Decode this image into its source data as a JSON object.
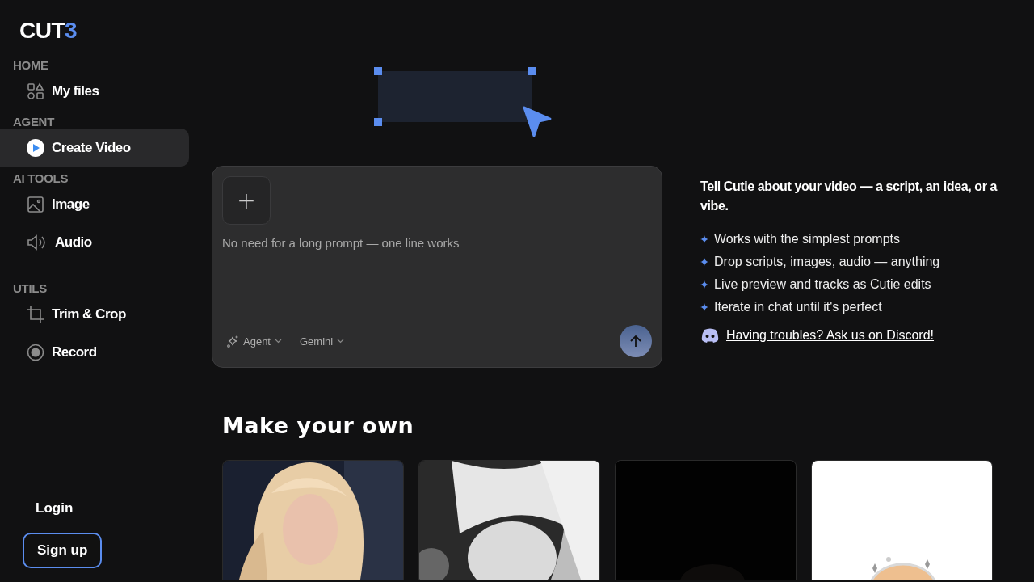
{
  "logo": {
    "text": "CUT",
    "accent": "3"
  },
  "sidebar": {
    "sections": [
      {
        "heading": "HOME",
        "items": [
          {
            "label": "My files",
            "selected": false
          }
        ]
      },
      {
        "heading": "AGENT",
        "items": [
          {
            "label": "Create Video",
            "selected": true
          }
        ]
      },
      {
        "heading": "AI TOOLS",
        "items": [
          {
            "label": "Image",
            "selected": false
          },
          {
            "label": "Audio",
            "selected": false
          }
        ]
      },
      {
        "heading": "UTILS",
        "items": [
          {
            "label": "Trim & Crop",
            "selected": false
          },
          {
            "label": "Record",
            "selected": false
          }
        ]
      }
    ],
    "login": "Login",
    "signup": "Sign up"
  },
  "prompt": {
    "attach": "+",
    "placeholder": "No need for a long prompt — one line works",
    "mode": "Agent",
    "model": "Gemini"
  },
  "info": {
    "intro": "Tell Cutie about your video — a script, an idea, or a vibe.",
    "bullets": [
      "Works with the simplest prompts",
      "Drop scripts, images, audio — anything",
      "Live preview and tracks as Cutie edits",
      "Iterate in chat until it's perfect"
    ],
    "link": "Having troubles? Ask us on Discord!"
  },
  "gallery": {
    "heading": "Make your own"
  }
}
